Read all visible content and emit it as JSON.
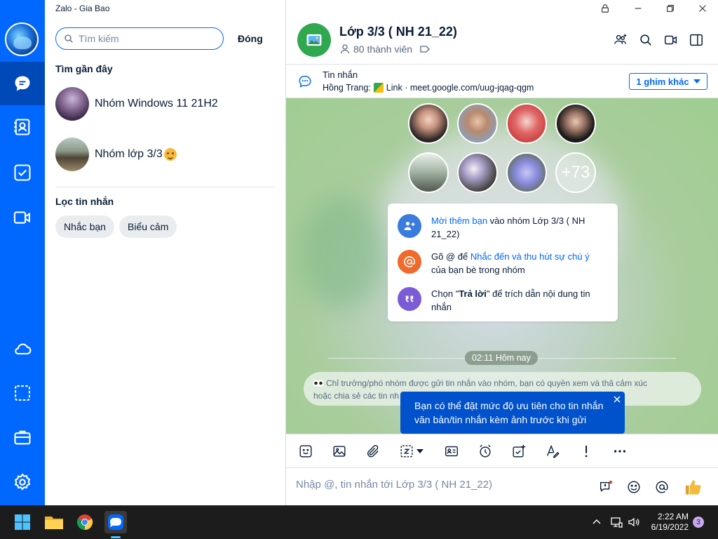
{
  "window": {
    "title": "Zalo - Gia Bao"
  },
  "search": {
    "placeholder": "Tìm kiếm",
    "close_label": "Đóng"
  },
  "recent": {
    "title": "Tìm gần đây",
    "items": [
      {
        "name": "Nhóm Windows 11 21H2"
      },
      {
        "name": "Nhóm lớp 3/3"
      }
    ]
  },
  "filter": {
    "title": "Lọc tin nhắn",
    "chips": [
      "Nhắc bạn",
      "Biểu cảm"
    ]
  },
  "chat": {
    "title": "Lớp 3/3 ( NH 21_22)",
    "members": "80 thành viên",
    "pinned": {
      "title": "Tin nhắn",
      "sender": "Hồng Trang:",
      "link_label": "Link",
      "link_text": "· meet.google.com/uug-jqag-qgm",
      "more_label": "1 ghim khác"
    },
    "more_members": "+73",
    "info": {
      "row1_link": "Mời thêm bạn",
      "row1_text": " vào nhóm Lớp 3/3 ( NH 21_22)",
      "row2_prefix": "Gõ @ để ",
      "row2_link": "Nhắc đến và thu hút sự chú ý",
      "row2_text": " của bạn bè trong nhóm",
      "row3_prefix": "Chọn \"",
      "row3_bold": "Trả lời",
      "row3_text": "\" để trích dẫn nội dung tin nhắn"
    },
    "time_label": "02:11 Hôm nay",
    "notice": "Chỉ trưởng/phó nhóm được gửi tin nhắn vào nhóm, bạn có quyền xem và thả cảm xúc",
    "notice_line2": "hoặc chia sẻ các tin nh",
    "tooltip": "Bạn có thể đặt mức độ ưu tiên cho tin nhắn văn bản/tin nhắn kèm ảnh trước khi gửi",
    "input_placeholder": "Nhập @, tin nhắn tới Lớp 3/3 ( NH 21_22)"
  },
  "taskbar": {
    "time": "2:22 AM",
    "date": "6/19/2022",
    "notif_count": "3",
    "zalo_label": "Zalo"
  },
  "colors": {
    "brand": "#0068ff",
    "rail": "#0068ff",
    "tooltip": "#0052cc",
    "chat_bg": "#9fcd90"
  }
}
